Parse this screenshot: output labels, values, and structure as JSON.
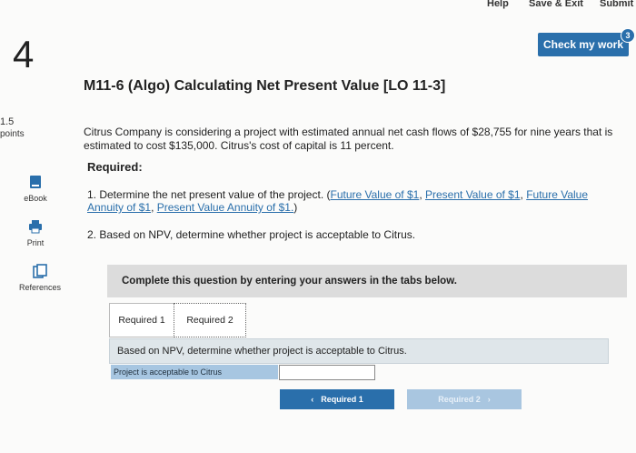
{
  "topbar": {
    "help": "Help",
    "save_exit": "Save & Exit",
    "submit": "Submit"
  },
  "question_number": "4",
  "check_work": {
    "label": "Check my work",
    "badge": "3"
  },
  "title": "M11-6 (Algo) Calculating Net Present Value [LO 11-3]",
  "points": {
    "value": "1.5",
    "label": "points"
  },
  "tools": [
    {
      "label": "eBook",
      "icon": "book-icon"
    },
    {
      "label": "Print",
      "icon": "printer-icon"
    },
    {
      "label": "References",
      "icon": "references-icon"
    }
  ],
  "prompt": "Citrus Company is considering a project with estimated annual net cash flows of $28,755 for nine years that is estimated to cost $135,000. Citrus's cost of capital is 11 percent.",
  "required_heading": "Required:",
  "req1": {
    "prefix": "1. Determine the net present value of the project. (",
    "links": [
      "Future Value of $1",
      "Present Value of $1",
      "Future Value Annuity of $1",
      "Present Value Annuity of $1."
    ],
    "suffix": ")"
  },
  "req2": "2. Based on NPV, determine whether project is acceptable to Citrus.",
  "instructions": "Complete this question by entering your answers in the tabs below.",
  "tabs": [
    "Required 1",
    "Required 2"
  ],
  "question_line": "Based on NPV, determine whether project is acceptable to Citrus.",
  "answer_label": "Project is acceptable to Citrus",
  "answer_value": "",
  "nav": {
    "prev": "Required 1",
    "next": "Required 2"
  },
  "colors": {
    "accent": "#2a6fab",
    "accent_light": "#a9c6e0"
  }
}
